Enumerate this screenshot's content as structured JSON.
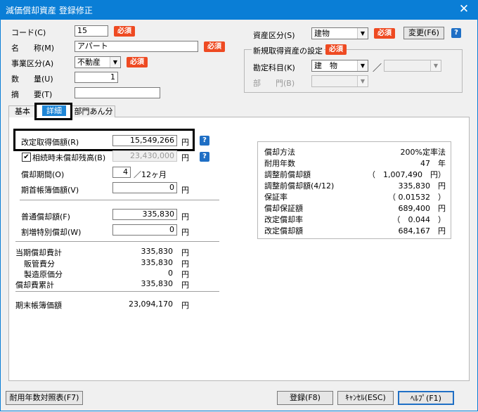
{
  "window": {
    "title": "減価償却資産 登録修正",
    "close_glyph": "✕"
  },
  "header": {
    "code_label": "コード(C)",
    "code_value": "15",
    "name_label_a": "名",
    "name_label_b": "称(M)",
    "name_value": "アパート",
    "category_label": "事業区分(A)",
    "category_value": "不動産",
    "quantity_label_a": "数",
    "quantity_label_b": "量(U)",
    "quantity_value": "1",
    "summary_label_a": "摘",
    "summary_label_b": "要(T)",
    "summary_value": "",
    "required_badge": "必須",
    "asset_class_label": "資産区分(S)",
    "asset_class_value": "建物",
    "change_button": "変更(F6)",
    "new_acq_group_title": "新規取得資産の設定",
    "account_label": "勘定科目(K)",
    "account_value": "建　物",
    "slash": "／",
    "dept_label_a": "部",
    "dept_label_b": "門(B)",
    "help_glyph": "?"
  },
  "tabs": [
    {
      "label": "基本"
    },
    {
      "label": "詳細"
    },
    {
      "label": "部門あん分"
    }
  ],
  "detail": {
    "revised_cost_label": "改定取得価額(R)",
    "revised_cost_value": "15,549,266",
    "inherit_checkbox_label": "相続時未償却残高(B)",
    "inherit_value": "23,430,000",
    "inherit_checked_glyph": "✔",
    "period_label": "償却期間(O)",
    "period_value": "4",
    "period_suffix": "／12ヶ月",
    "opening_book_label": "期首帳簿価額(V)",
    "opening_book_value": "0",
    "normal_dep_label": "普通償却額(F)",
    "normal_dep_value": "335,830",
    "special_dep_label": "割増特別償却(W)",
    "special_dep_value": "0",
    "yen": "円",
    "current_dep_label": "当期償却費計",
    "current_dep_value": "335,830",
    "sales_admin_label": "販管費分",
    "sales_admin_value": "335,830",
    "manufacturing_label": "製造原価分",
    "manufacturing_value": "0",
    "accumulated_label": "償却費累計",
    "accumulated_value": "335,830",
    "ending_book_label": "期末帳簿価額",
    "ending_book_value": "23,094,170"
  },
  "calc": {
    "rows": [
      {
        "label": "償却方法",
        "value": "200%定率法"
      },
      {
        "label": "耐用年数",
        "value": "47　年"
      },
      {
        "label": "調整前償却額",
        "value": "（　1,007,490　円）"
      },
      {
        "label": "調整前償却額(4/12)",
        "value": "335,830　円"
      },
      {
        "label": "保証率",
        "value": "（ 0.01532　）"
      },
      {
        "label": "償却保証額",
        "value": "689,400　円"
      },
      {
        "label": "改定償却率",
        "value": "（　0.044　）"
      },
      {
        "label": "改定償却額",
        "value": "684,167　円"
      }
    ]
  },
  "footer": {
    "useful_life_table_button": "耐用年数対照表(F7)",
    "register_button": "登録(F8)",
    "cancel_button": "ｷｬﾝｾﾙ(ESC)",
    "help_button": "ﾍﾙﾌﾟ(F1)"
  }
}
